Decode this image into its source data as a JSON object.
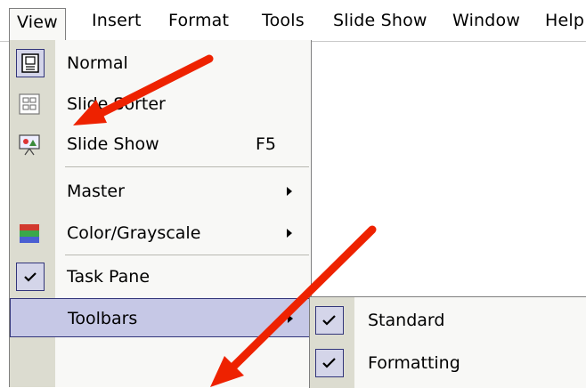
{
  "menubar": {
    "items": [
      {
        "label": "View",
        "open": true
      },
      {
        "label": "Insert"
      },
      {
        "label": "Format"
      },
      {
        "label": "Tools"
      },
      {
        "label": "Slide Show"
      },
      {
        "label": "Window"
      },
      {
        "label": "Help"
      }
    ]
  },
  "view_menu": {
    "items": [
      {
        "label": "Normal",
        "icon": "normal-view-icon",
        "selected": true
      },
      {
        "label": "Slide Sorter",
        "icon": "slide-sorter-icon"
      },
      {
        "label": "Slide Show",
        "icon": "slide-show-icon",
        "shortcut": "F5"
      },
      {
        "label": "Master",
        "submenu": true
      },
      {
        "label": "Color/Grayscale",
        "icon": "color-grayscale-icon",
        "submenu": true
      },
      {
        "label": "Task Pane",
        "icon": "check-icon",
        "checked": true
      },
      {
        "label": "Toolbars",
        "submenu": true,
        "highlighted": true
      }
    ]
  },
  "toolbars_submenu": {
    "items": [
      {
        "label": "Standard",
        "checked": true
      },
      {
        "label": "Formatting",
        "checked": true
      }
    ]
  },
  "colors": {
    "highlight": "#c6c8e6",
    "highlight_border": "#32357a",
    "gutter": "#dcdcd0",
    "menu_bg": "#f8f8f6",
    "annotation_arrow": "#ee2200"
  }
}
